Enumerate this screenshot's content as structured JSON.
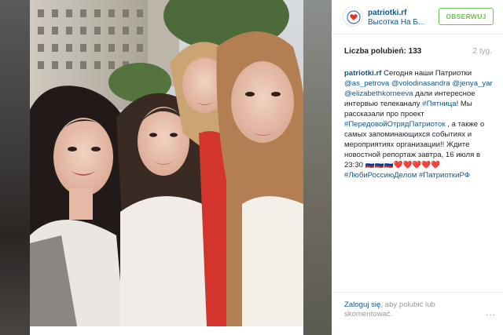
{
  "header": {
    "username": "patriotki.rf",
    "location": "Высотка На Б...",
    "follow_label": "OBSERWUJ"
  },
  "stats": {
    "likes_label": "Liczba polubień:",
    "likes_count": "133",
    "time_ago": "2 tyg."
  },
  "caption": {
    "author": "patriotki.rf",
    "text_1": " Сегодня наши Патриотки ",
    "mention_1": "@as_petrova",
    "mention_2": "@volodinasandra",
    "mention_3": "@jenya_yar",
    "mention_4": "@elizabethkorneeva",
    "text_2": " дали интересное интервью телеканалу ",
    "hashtag_1": "#Пятница",
    "text_3": "! Мы рассказали про проект ",
    "hashtag_2": "#ПередовойОтрядПатриоток",
    "text_4": " , а также о самых запоминающихся событиях и мероприятиях организации!! Ждите новостной репортаж завтра, 16 июля в 23:30 🇷🇺🇷🇺🇷🇺❤️❤️❤️❤️❤️",
    "hashtag_3": "#ЛюбиРоссиюДелом",
    "hashtag_4": "#ПатриоткиРФ"
  },
  "footer": {
    "login_link": "Zaloguj się",
    "login_rest": ", aby polubić lub skomentować.",
    "more_label": "..."
  },
  "colors": {
    "link": "#125688",
    "follow_green": "#70c050",
    "muted": "#999999",
    "logo_heart": "#e0322d",
    "logo_ring": "#2a5aa5"
  },
  "icons": {
    "logo": "heart-logo-icon",
    "more": "more-options-icon"
  }
}
